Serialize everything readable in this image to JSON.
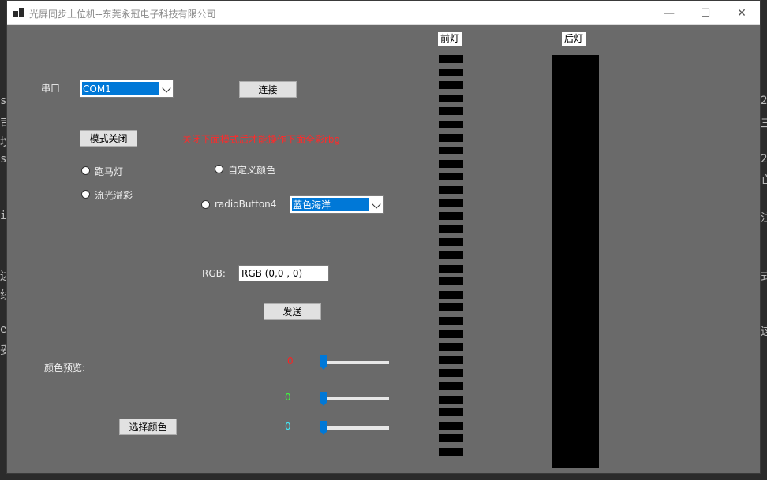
{
  "window": {
    "title": "光屏同步上位机--东莞永冠电子科技有限公司",
    "minimize_glyph": "—",
    "maximize_glyph": "☐",
    "close_glyph": "✕"
  },
  "serial": {
    "label": "串口",
    "port": "COM1",
    "connect_label": "连接"
  },
  "mode": {
    "close_label": "模式关闭",
    "warning": "关闭下面模式后才能操作下面全彩rbg",
    "warning_color": "#ff2a2a"
  },
  "effects": {
    "marquee": "跑马灯",
    "flow": "流光溢彩",
    "custom_color": "自定义颜色",
    "radio4": "radioButton4",
    "preset": "蓝色海洋"
  },
  "rgb": {
    "label": "RGB:",
    "value": "RGB  (0,0 , 0)",
    "send_label": "发送"
  },
  "preview": {
    "label": "颜色预览:",
    "choose_label": "选择颜色",
    "r_value": "0",
    "g_value": "0",
    "b_value": "0",
    "r_color": "#ff2020",
    "g_color": "#3cff3c",
    "b_color": "#40f0ff",
    "r_level": 0,
    "g_level": 0,
    "b_level": 0
  },
  "lights": {
    "front_label": "前灯",
    "rear_label": "后灯",
    "front_segment_count": 31
  },
  "background_text": {
    "left": [
      "s",
      "司",
      "坟",
      "s",
      "i",
      "边",
      "线",
      "e",
      "妥"
    ],
    "right": [
      "2",
      "三",
      "2",
      "亡",
      "注",
      "式",
      "这"
    ]
  }
}
